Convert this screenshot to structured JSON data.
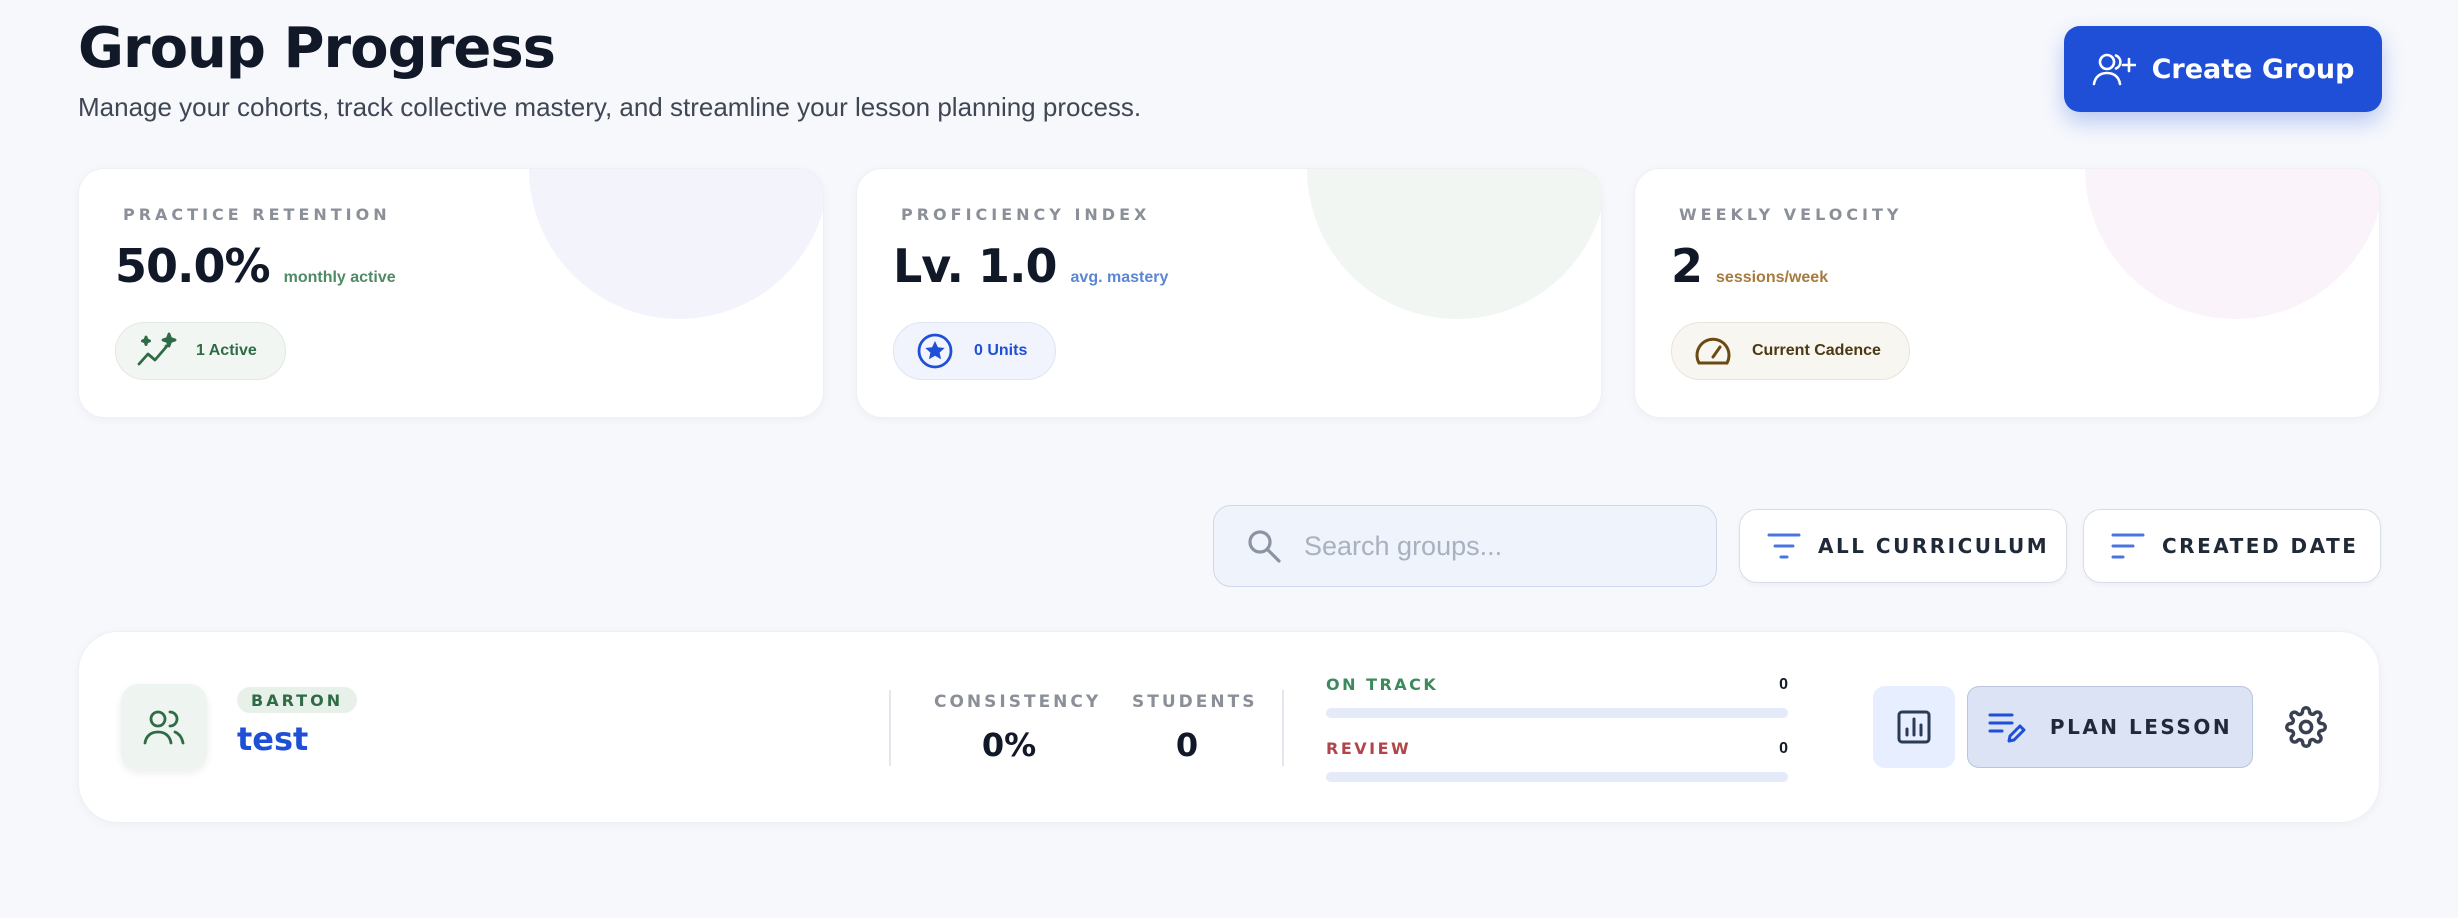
{
  "header": {
    "title": "Group Progress",
    "subtitle": "Manage your cohorts, track collective mastery, and streamline your lesson planning process.",
    "create_label": "Create Group"
  },
  "stats": [
    {
      "label": "PRACTICE RETENTION",
      "value": "50.0%",
      "unit": "monthly active",
      "pill": "1 Active",
      "icon": "trending-sparkle-icon",
      "accent": "#2f6b45"
    },
    {
      "label": "PROFICIENCY INDEX",
      "value": "Lv. 1.0",
      "unit": "avg. mastery",
      "pill": "0 Units",
      "icon": "star-badge-icon",
      "accent": "#1f4fd6"
    },
    {
      "label": "WEEKLY VELOCITY",
      "value": "2",
      "unit": "sessions/week",
      "pill": "Current Cadence",
      "icon": "speedometer-icon",
      "accent": "#6b4a12"
    }
  ],
  "filters": {
    "search_placeholder": "Search groups...",
    "search_value": "",
    "curriculum_label": "ALL CURRICULUM",
    "sort_label": "CREATED DATE"
  },
  "groups": [
    {
      "tag": "BARTON",
      "name": "test",
      "consistency_label": "CONSISTENCY",
      "consistency_value": "0%",
      "students_label": "STUDENTS",
      "students_value": "0",
      "on_track_label": "ON TRACK",
      "on_track_value": "0",
      "on_track_fraction": 0,
      "review_label": "REVIEW",
      "review_value": "0",
      "review_fraction": 0,
      "plan_label": "PLAN LESSON"
    }
  ],
  "colors": {
    "primary": "#1f4fd6",
    "success": "#2f6b45",
    "warning": "#b0464a",
    "background": "#f6f8fc"
  }
}
